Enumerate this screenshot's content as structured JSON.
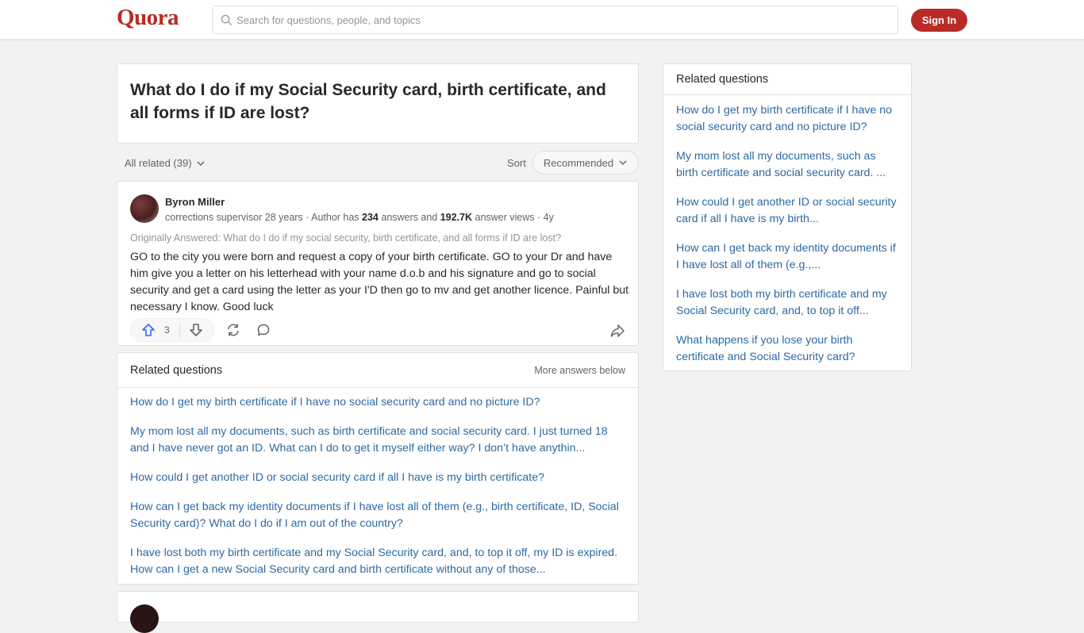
{
  "header": {
    "logo": "Quora",
    "search_placeholder": "Search for questions, people, and topics",
    "signin_label": "Sign In"
  },
  "question": {
    "title": "What do I do if my Social Security card, birth certificate, and all forms if ID are lost?"
  },
  "filters": {
    "all_related": "All related (39)",
    "sort_label": "Sort",
    "sort_value": "Recommended"
  },
  "answer": {
    "author": "Byron Miller",
    "credential_prefix": "corrections supervisor 28 years · Author has ",
    "answers_count": "234",
    "credential_mid": " answers and ",
    "views_count": "192.7K",
    "credential_suffix": " answer views · 4y",
    "originally_answered": "Originally Answered: What do I do if my social security, birth certificate, and all forms if ID are lost?",
    "body": "GO to the city you were born and request a copy of your birth certificate. GO to your Dr and have him give you a letter on his letterhead with your name d.o.b and his signature and go to social security and get a card using the letter as your I'D then go to mv and get another licence. Painful but necessary I know. Good luck",
    "upvotes": "3",
    "icons": [
      "upvote-icon",
      "downvote-icon",
      "share-repost-icon",
      "comment-icon",
      "share-icon"
    ]
  },
  "related_inline": {
    "title": "Related questions",
    "more": "More answers below",
    "items": [
      "How do I get my birth certificate if I have no social security card and no picture ID?",
      "My mom lost all my documents, such as birth certificate and social security card. I just turned 18 and I have never got an ID. What can I do to get it myself either way? I don’t have anythin...",
      "How could I get another ID or social security card if all I have is my birth certificate?",
      "How can I get back my identity documents if I have lost all of them (e.g., birth certificate, ID, Social Security card)? What do I do if I am out of the country?",
      "I have lost both my birth certificate and my Social Security card, and, to top it off, my ID is expired. How can I get a new Social Security card and birth certificate without any of those..."
    ]
  },
  "sidebar": {
    "title": "Related questions",
    "items": [
      "How do I get my birth certificate if I have no social security card and no picture ID?",
      "My mom lost all my documents, such as birth certificate and social security card. ...",
      "How could I get another ID or social security card if all I have is my birth...",
      "How can I get back my identity documents if I have lost all of them (e.g.,...",
      "I have lost both my birth certificate and my Social Security card, and, to top it off...",
      "What happens if you lose your birth certificate and Social Security card?"
    ]
  },
  "colors": {
    "brand": "#b92b27",
    "link": "#2e69a3",
    "upvote": "#2e69ff"
  }
}
